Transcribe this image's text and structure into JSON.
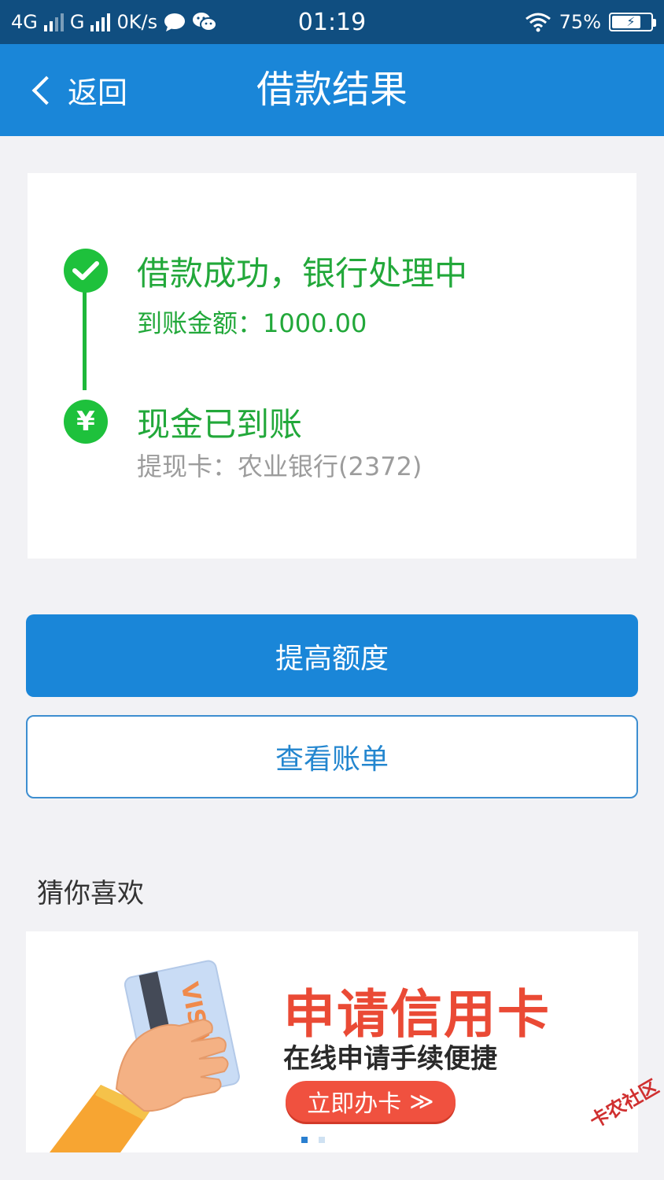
{
  "status_bar": {
    "network_1": "4G",
    "network_2": "G",
    "speed": "0K/s",
    "time": "01:19",
    "battery": "75%",
    "battery_level": 0.75
  },
  "nav": {
    "back_label": "返回",
    "title": "借款结果"
  },
  "result": {
    "step1_title": "借款成功，银行处理中",
    "step1_amount": "到账金额：1000.00",
    "step2_icon": "¥",
    "step2_title": "现金已到账",
    "step2_card": "提现卡：农业银行(2372)"
  },
  "actions": {
    "primary_label": "提高额度",
    "secondary_label": "查看账单"
  },
  "recommend": {
    "section_title": "猜你喜欢",
    "banner": {
      "headline": "申请信用卡",
      "subline": "在线申请手续便捷",
      "cta": "立即办卡",
      "cta_arrow": "≫",
      "card_brand": "VISA",
      "dots_total": 2,
      "dots_active": 1
    }
  },
  "watermark": "卡农社区",
  "colors": {
    "status_bar": "#104e80",
    "nav_bar": "#1a86d8",
    "success_green": "#1ec13c",
    "banner_red": "#ea4a35"
  }
}
